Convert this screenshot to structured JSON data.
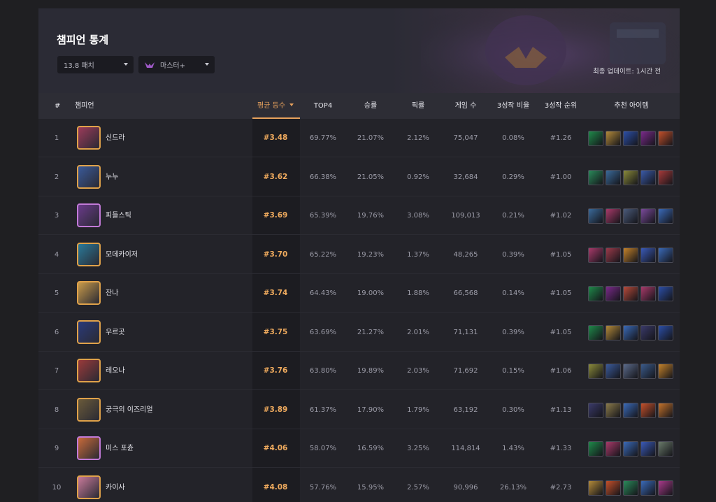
{
  "page": {
    "title": "챔피언 통계",
    "patch_select": "13.8 패치",
    "tier_select": "마스터+",
    "last_update": "최종 업데이트: 1시간 전"
  },
  "colors": {
    "accent": "#e8a25d",
    "gold_border": "#e0a24a",
    "purple_border": "#c27ad8"
  },
  "table": {
    "headers": [
      "#",
      "챔피언",
      "평균 등수",
      "TOP4",
      "승률",
      "픽률",
      "게임 수",
      "3성작 비율",
      "3성작 순위",
      "추천 아이템"
    ],
    "rows": [
      {
        "rank": "1",
        "name": "신드라",
        "avg": "#3.48",
        "top4": "69.77%",
        "win": "21.07%",
        "pick": "2.12%",
        "games": "75,047",
        "star3_rate": "0.08%",
        "star3_rank": "#1.26",
        "border": "gold",
        "portrait": "#9b3b5a",
        "items": [
          "#1f8a4a",
          "#b38a3a",
          "#2c4fa8",
          "#7a2a8a",
          "#c4502a"
        ]
      },
      {
        "rank": "2",
        "name": "누누",
        "avg": "#3.62",
        "top4": "66.38%",
        "win": "21.05%",
        "pick": "0.92%",
        "games": "32,684",
        "star3_rate": "0.29%",
        "star3_rank": "#1.00",
        "border": "gold",
        "portrait": "#3a5a9a",
        "items": [
          "#2a8a5a",
          "#3a6a9a",
          "#8a8a3a",
          "#3a5aa8",
          "#a83a3a"
        ]
      },
      {
        "rank": "3",
        "name": "피들스틱",
        "avg": "#3.69",
        "top4": "65.39%",
        "win": "19.76%",
        "pick": "3.08%",
        "games": "109,013",
        "star3_rate": "0.21%",
        "star3_rank": "#1.02",
        "border": "purple",
        "portrait": "#6a3a8a",
        "items": [
          "#3a6a9a",
          "#a83a6a",
          "#4a5a7a",
          "#7a4a9a",
          "#3a6ab8"
        ]
      },
      {
        "rank": "4",
        "name": "모데카이저",
        "avg": "#3.70",
        "top4": "65.22%",
        "win": "19.23%",
        "pick": "1.37%",
        "games": "48,265",
        "star3_rate": "0.39%",
        "star3_rank": "#1.05",
        "border": "gold",
        "portrait": "#2a7a9a",
        "items": [
          "#a83a6a",
          "#9a3a4a",
          "#c4822a",
          "#3a5ab8",
          "#3a6ab8"
        ]
      },
      {
        "rank": "5",
        "name": "잔나",
        "avg": "#3.74",
        "top4": "64.43%",
        "win": "19.00%",
        "pick": "1.88%",
        "games": "66,568",
        "star3_rate": "0.14%",
        "star3_rank": "#1.05",
        "border": "gold",
        "portrait": "#c89a4a",
        "items": [
          "#1f8a4a",
          "#7a2a8a",
          "#b84a3a",
          "#a83a6a",
          "#2c4fa8"
        ]
      },
      {
        "rank": "6",
        "name": "우르곳",
        "avg": "#3.75",
        "top4": "63.69%",
        "win": "21.27%",
        "pick": "2.01%",
        "games": "71,131",
        "star3_rate": "0.39%",
        "star3_rank": "#1.05",
        "border": "gold",
        "portrait": "#2a3a7a",
        "items": [
          "#1f8a4a",
          "#b38a3a",
          "#3a6ab8",
          "#3a3a6a",
          "#2c4fa8"
        ]
      },
      {
        "rank": "7",
        "name": "레오나",
        "avg": "#3.76",
        "top4": "63.80%",
        "win": "19.89%",
        "pick": "2.03%",
        "games": "71,692",
        "star3_rate": "0.15%",
        "star3_rank": "#1.06",
        "border": "gold",
        "portrait": "#9a3a3a",
        "items": [
          "#8a8a3a",
          "#3a5a9a",
          "#5a6a8a",
          "#3a5a8a",
          "#c4822a"
        ]
      },
      {
        "rank": "8",
        "name": "궁극의 이즈리얼",
        "avg": "#3.89",
        "top4": "61.37%",
        "win": "17.90%",
        "pick": "1.79%",
        "games": "63,192",
        "star3_rate": "0.30%",
        "star3_rank": "#1.13",
        "border": "gold",
        "portrait": "#6a5a3a",
        "items": [
          "#3a3a6a",
          "#8a7a4a",
          "#3a6ab8",
          "#c4502a",
          "#c4722a"
        ]
      },
      {
        "rank": "9",
        "name": "미스 포츈",
        "avg": "#4.06",
        "top4": "58.07%",
        "win": "16.59%",
        "pick": "3.25%",
        "games": "114,814",
        "star3_rate": "1.43%",
        "star3_rank": "#1.33",
        "border": "purple",
        "portrait": "#c86a3a",
        "items": [
          "#1f8a4a",
          "#a83a6a",
          "#3a6ab8",
          "#3a5ab8",
          "#6a7a6a"
        ]
      },
      {
        "rank": "10",
        "name": "카이사",
        "avg": "#4.08",
        "top4": "57.76%",
        "win": "15.95%",
        "pick": "2.57%",
        "games": "90,996",
        "star3_rate": "26.13%",
        "star3_rank": "#2.73",
        "border": "gold",
        "portrait": "#c87a9a",
        "items": [
          "#b38a3a",
          "#c4502a",
          "#2a8a5a",
          "#3a6ab8",
          "#a83a8a"
        ]
      }
    ]
  }
}
